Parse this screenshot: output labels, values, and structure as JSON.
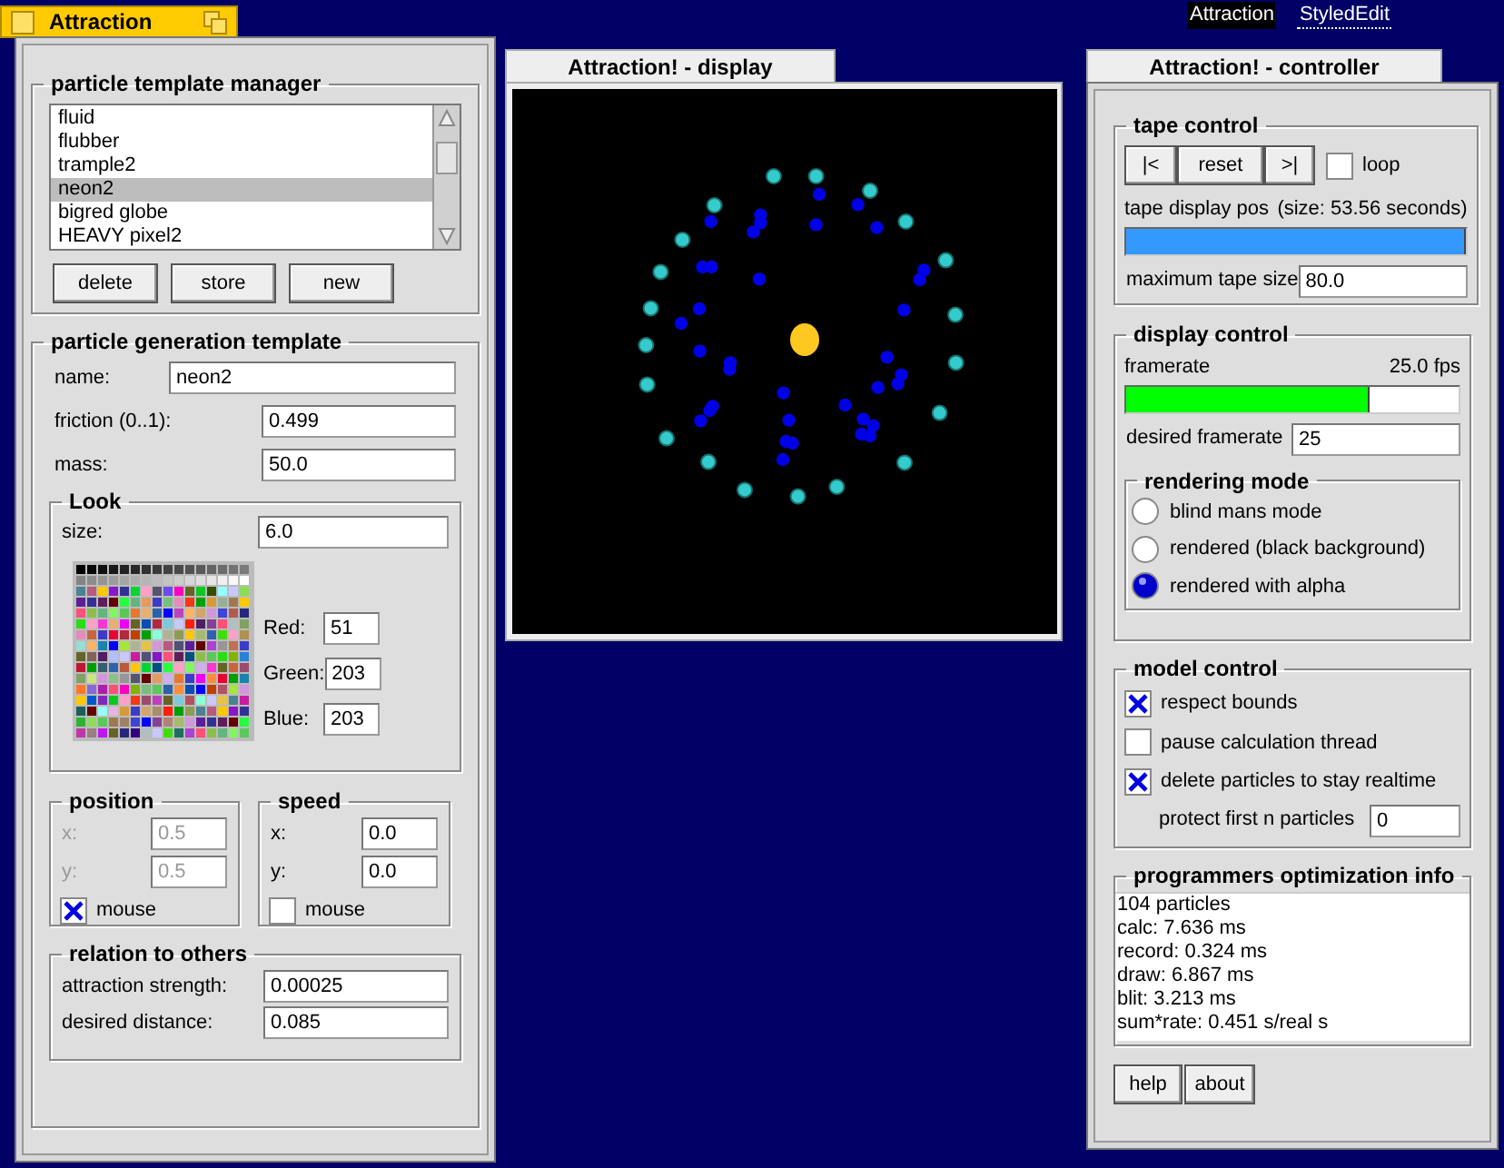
{
  "deskbar": {
    "items": [
      {
        "label": "Attraction",
        "selected": true
      },
      {
        "label": "StyledEdit",
        "selected": false
      }
    ]
  },
  "main_window": {
    "title": "Attraction",
    "active": true,
    "template_manager": {
      "title": "particle template manager",
      "items": [
        {
          "label": "fluid",
          "selected": false
        },
        {
          "label": "flubber",
          "selected": false
        },
        {
          "label": "trample2",
          "selected": false
        },
        {
          "label": "neon2",
          "selected": true
        },
        {
          "label": "bigred globe",
          "selected": false
        },
        {
          "label": "HEAVY pixel2",
          "selected": false
        }
      ],
      "buttons": [
        "delete",
        "store",
        "new"
      ]
    },
    "generation_template": {
      "title": "particle generation template",
      "fields": [
        {
          "label": "name:",
          "value": "neon2",
          "kind": "wide"
        },
        {
          "label": "friction (0..1):",
          "value": "0.499",
          "kind": "narrow"
        },
        {
          "label": "mass:",
          "value": "50.0",
          "kind": "narrow"
        }
      ],
      "look": {
        "title": "Look",
        "size": {
          "label": "size:",
          "value": "6.0"
        },
        "color": [
          {
            "label": "Red:",
            "value": "51"
          },
          {
            "label": "Green:",
            "value": "203"
          },
          {
            "label": "Blue:",
            "value": "203"
          }
        ]
      },
      "position": {
        "title": "position",
        "disabled": true,
        "fields": [
          {
            "label": "x:",
            "value": "0.5"
          },
          {
            "label": "y:",
            "value": "0.5"
          }
        ],
        "mouse": {
          "label": "mouse",
          "checked": true
        }
      },
      "speed": {
        "title": "speed",
        "disabled": false,
        "fields": [
          {
            "label": "x:",
            "value": "0.0"
          },
          {
            "label": "y:",
            "value": "0.0"
          }
        ],
        "mouse": {
          "label": "mouse",
          "checked": false
        }
      },
      "relation": {
        "title": "relation to others",
        "fields": [
          {
            "label": "attraction strength:",
            "value": "0.00025"
          },
          {
            "label": "desired distance:",
            "value": "0.085"
          }
        ]
      }
    }
  },
  "display_window": {
    "title": "Attraction! - display"
  },
  "controller_window": {
    "title": "Attraction! - controller",
    "tape_control": {
      "title": "tape control",
      "buttons": [
        "|<",
        "reset",
        ">|"
      ],
      "loop": {
        "label": "loop",
        "checked": false
      },
      "position_label": "tape display pos",
      "size_text": "(size: 53.56 seconds)",
      "level": 1.0,
      "max_size": {
        "label": "maximum tape size",
        "value": "80.0"
      }
    },
    "display_control": {
      "title": "display control",
      "framerate_label": "framerate",
      "framerate_value": "25.0 fps",
      "level": 0.73,
      "desired": {
        "label": "desired framerate",
        "value": "25"
      },
      "rendering_mode": {
        "title": "rendering mode",
        "options": [
          {
            "label": "blind mans mode",
            "selected": false
          },
          {
            "label": "rendered (black background)",
            "selected": false
          },
          {
            "label": "rendered with alpha",
            "selected": true
          }
        ]
      }
    },
    "model_control": {
      "title": "model control",
      "options": [
        {
          "label": "respect bounds",
          "checked": true
        },
        {
          "label": "pause calculation thread",
          "checked": false
        },
        {
          "label": "delete particles to stay realtime",
          "checked": true
        }
      ],
      "protect": {
        "label": "protect first n particles",
        "value": "0"
      }
    },
    "info": {
      "title": "programmers optimization info",
      "lines": [
        "104 particles",
        "calc: 7.636 ms",
        "record: 0.324 ms",
        "draw: 6.867 ms",
        "blit: 3.213 ms",
        "sum*rate: 0.451 s/real s"
      ]
    },
    "buttons": [
      "help",
      "about"
    ]
  }
}
